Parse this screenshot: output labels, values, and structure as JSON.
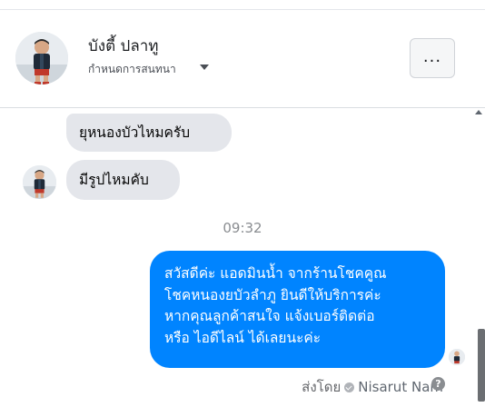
{
  "header": {
    "contact_name": "บังตี้ ปลาทู",
    "subtitle": "กำหนดการสนทนา",
    "more_label": "..."
  },
  "messages": [
    {
      "direction": "incoming",
      "text": "ยุหนองบัวไหมครับ"
    },
    {
      "direction": "incoming",
      "text": "มีรูปไหมคับ"
    }
  ],
  "timestamp": "09:32",
  "outgoing": {
    "lines": [
      "สวัสดีค่ะ แอดมินน้ำ จากร้านโชคคูณ",
      "โชคหนองยบัวลำภู ยินดีให้บริการค่ะ",
      "หากคุณลูกค้าสนใจ แจ้งเบอร์ติดต่อ",
      "หรือ ไอดีไลน์ ได้เลยนะค่ะ"
    ]
  },
  "sent_by": {
    "prefix": "ส่งโดย",
    "sender": "Nisarut Nam",
    "help": "?"
  },
  "colors": {
    "outgoing_bubble": "#0084ff",
    "incoming_bubble": "#e4e6eb",
    "text": "#050505",
    "muted": "#65676b"
  },
  "icons": [
    "profile-avatar",
    "chevron-down-icon",
    "more-options-icon",
    "verified-check-icon",
    "help-icon"
  ]
}
